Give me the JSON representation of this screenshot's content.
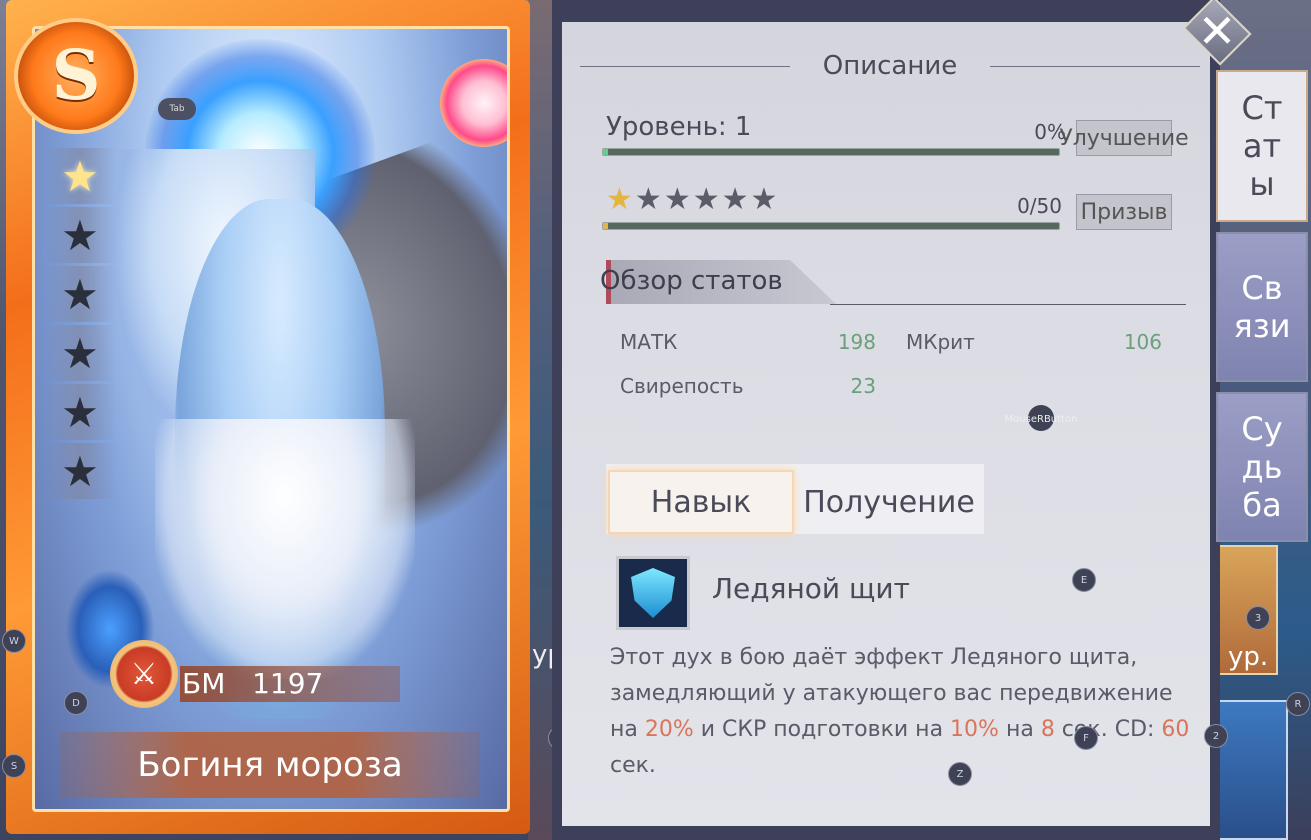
{
  "hero": {
    "rank": "S",
    "stars_total": 6,
    "stars_filled": 1,
    "bm_label": "БМ",
    "bm_value": "1197",
    "name": "Богиня мороза"
  },
  "hints": {
    "tab": "Tab",
    "w": "W",
    "d": "D",
    "s": "S",
    "q": "Q",
    "z": "Z",
    "e": "E",
    "f": "F",
    "r": "R",
    "k2": "2",
    "k3": "3",
    "mouse": "MouseRButton"
  },
  "panel": {
    "title": "Описание",
    "level_label": "Уровень: 1",
    "level_percent": "0%",
    "level_progress": 0.01,
    "upgrade_button": "Улучшение",
    "stars_count": "0/50",
    "stars_progress": 0.01,
    "summon_button": "Призыв",
    "section_title": "Обзор статов",
    "stats": [
      {
        "name": "МАТК",
        "value": "198"
      },
      {
        "name": "МКрит",
        "value": "106"
      },
      {
        "name": "Свирепость",
        "value": "23"
      }
    ],
    "tabs": {
      "skill": "Навык",
      "obtain": "Получение"
    },
    "skill": {
      "name": "Ледяной щит",
      "desc_1": "Этот дух в бою даёт эффект Ледяного щита, замедляющий у атакующего вас передвижение на ",
      "pct_1": "20%",
      "desc_2": " и СКР подготовки на ",
      "pct_2": "10%",
      "desc_3": " на ",
      "sec": "8",
      "desc_4": " сек. CD: ",
      "cd": "60",
      "desc_5": " сек."
    }
  },
  "side_tabs": {
    "stats": "Ст\nат\nы",
    "links": "Св\nязи",
    "fate": "Су\nдь\nба"
  },
  "bg_labels": {
    "left_ur": "ур",
    "right_ur": "ур."
  },
  "colors": {
    "accent_orange": "#f46e1a",
    "highlight": "#d9755a",
    "stat_value": "#6aa07a"
  }
}
